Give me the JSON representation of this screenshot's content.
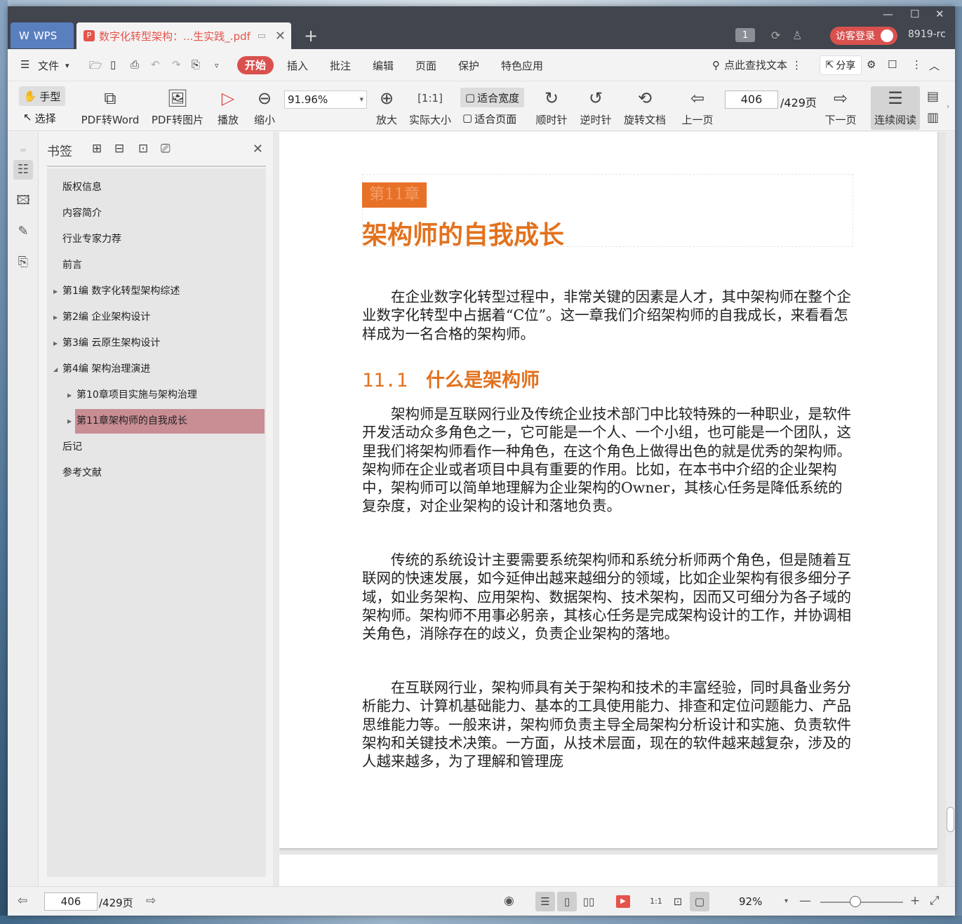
{
  "titlebar": {
    "app_tab": "WPS",
    "doc_tab_title": "数字化转型架构：...生实践_.pdf",
    "new_tab": "+",
    "page_badge": "1",
    "login_label": "访客登录",
    "user_id": "8919-rc",
    "minimize": "—",
    "maximize": "☐",
    "close": "✕"
  },
  "menubar": {
    "file": "文件",
    "start": "开始",
    "items": [
      "插入",
      "批注",
      "编辑",
      "页面",
      "保护",
      "特色应用"
    ],
    "search": "点此查找文本",
    "share": "分享"
  },
  "toolbar": {
    "hand": "手型",
    "select": "选择",
    "pdf_to_word": "PDF转Word",
    "pdf_to_image": "PDF转图片",
    "play": "播放",
    "zoom_out": "缩小",
    "zoom_value": "91.96%",
    "zoom_in": "放大",
    "actual_size": "实际大小",
    "fit_width": "适合宽度",
    "fit_page": "适合页面",
    "rotate_cw": "顺时针",
    "rotate_ccw": "逆时针",
    "rotate_doc": "旋转文档",
    "prev_page": "上一页",
    "page_current": "406",
    "page_total": "/429页",
    "next_page": "下一页",
    "continuous": "连续阅读"
  },
  "bookmarks": {
    "title": "书签",
    "items": [
      {
        "label": "版权信息",
        "level": 0,
        "arrow": ""
      },
      {
        "label": "内容简介",
        "level": 0,
        "arrow": ""
      },
      {
        "label": "行业专家力荐",
        "level": 0,
        "arrow": ""
      },
      {
        "label": "前言",
        "level": 0,
        "arrow": ""
      },
      {
        "label": "第1编 数字化转型架构综述",
        "level": 0,
        "arrow": "▶"
      },
      {
        "label": "第2编 企业架构设计",
        "level": 0,
        "arrow": "▶"
      },
      {
        "label": "第3编 云原生架构设计",
        "level": 0,
        "arrow": "▶"
      },
      {
        "label": "第4编 架构治理演进",
        "level": 0,
        "arrow": "◢"
      },
      {
        "label": "第10章项目实施与架构治理",
        "level": 1,
        "arrow": "▶"
      },
      {
        "label": "第11章架构师的自我成长",
        "level": 1,
        "arrow": "▶",
        "active": true
      },
      {
        "label": "后记",
        "level": 0,
        "arrow": ""
      },
      {
        "label": "参考文献",
        "level": 0,
        "arrow": ""
      }
    ]
  },
  "document": {
    "chapter_tag": "第11章",
    "chapter_title": "架构师的自我成长",
    "intro": "在企业数字化转型过程中，非常关键的因素是人才，其中架构师在整个企业数字化转型中占据着“C位”。这一章我们介绍架构师的自我成长，来看看怎样成为一名合格的架构师。",
    "section_num": "11.1",
    "section_title": "什么是架构师",
    "p1": "架构师是互联网行业及传统企业技术部门中比较特殊的一种职业，是软件开发活动众多角色之一，它可能是一个人、一个小组，也可能是一个团队，这里我们将架构师看作一种角色，在这个角色上做得出色的就是优秀的架构师。架构师在企业或者项目中具有重要的作用。比如，在本书中介绍的企业架构中，架构师可以简单地理解为企业架构的Owner，其核心任务是降低系统的复杂度，对企业架构的设计和落地负责。",
    "p2": "传统的系统设计主要需要系统架构师和系统分析师两个角色，但是随着互联网的快速发展，如今延伸出越来越细分的领域，比如企业架构有很多细分子域，如业务架构、应用架构、数据架构、技术架构，因而又可细分为各子域的架构师。架构师不用事必躬亲，其核心任务是完成架构设计的工作，并协调相关角色，消除存在的歧义，负责企业架构的落地。",
    "p3": "在互联网行业，架构师具有关于架构和技术的丰富经验，同时具备业务分析能力、计算机基础能力、基本的工具使用能力、排查和定位问题能力、产品思维能力等。一般来讲，架构师负责主导全局架构分析设计和实施、负责软件架构和关键技术决策。一方面，从技术层面，现在的软件越来越复杂，涉及的人越来越多，为了理解和管理庞"
  },
  "statusbar": {
    "page_current": "406",
    "page_total": "/429页",
    "zoom": "92%"
  },
  "colors": {
    "accent": "#d9514e",
    "chapter_orange": "#e2721f",
    "bookmark_active": "#c98d94"
  }
}
